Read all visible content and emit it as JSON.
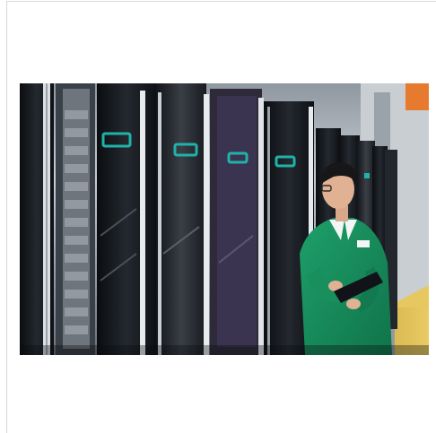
{
  "image": {
    "alt": "",
    "subject": "data-center-server-racks-with-technician",
    "colors": {
      "accent": "#20b2aa",
      "uniform": "#178f5c",
      "rack_dark": "#111417",
      "rack_mid": "#2a2f35",
      "background_light": "#d7dde3",
      "floor_accent": "#f0c53a",
      "orange_panel": "#e67a2f"
    }
  }
}
